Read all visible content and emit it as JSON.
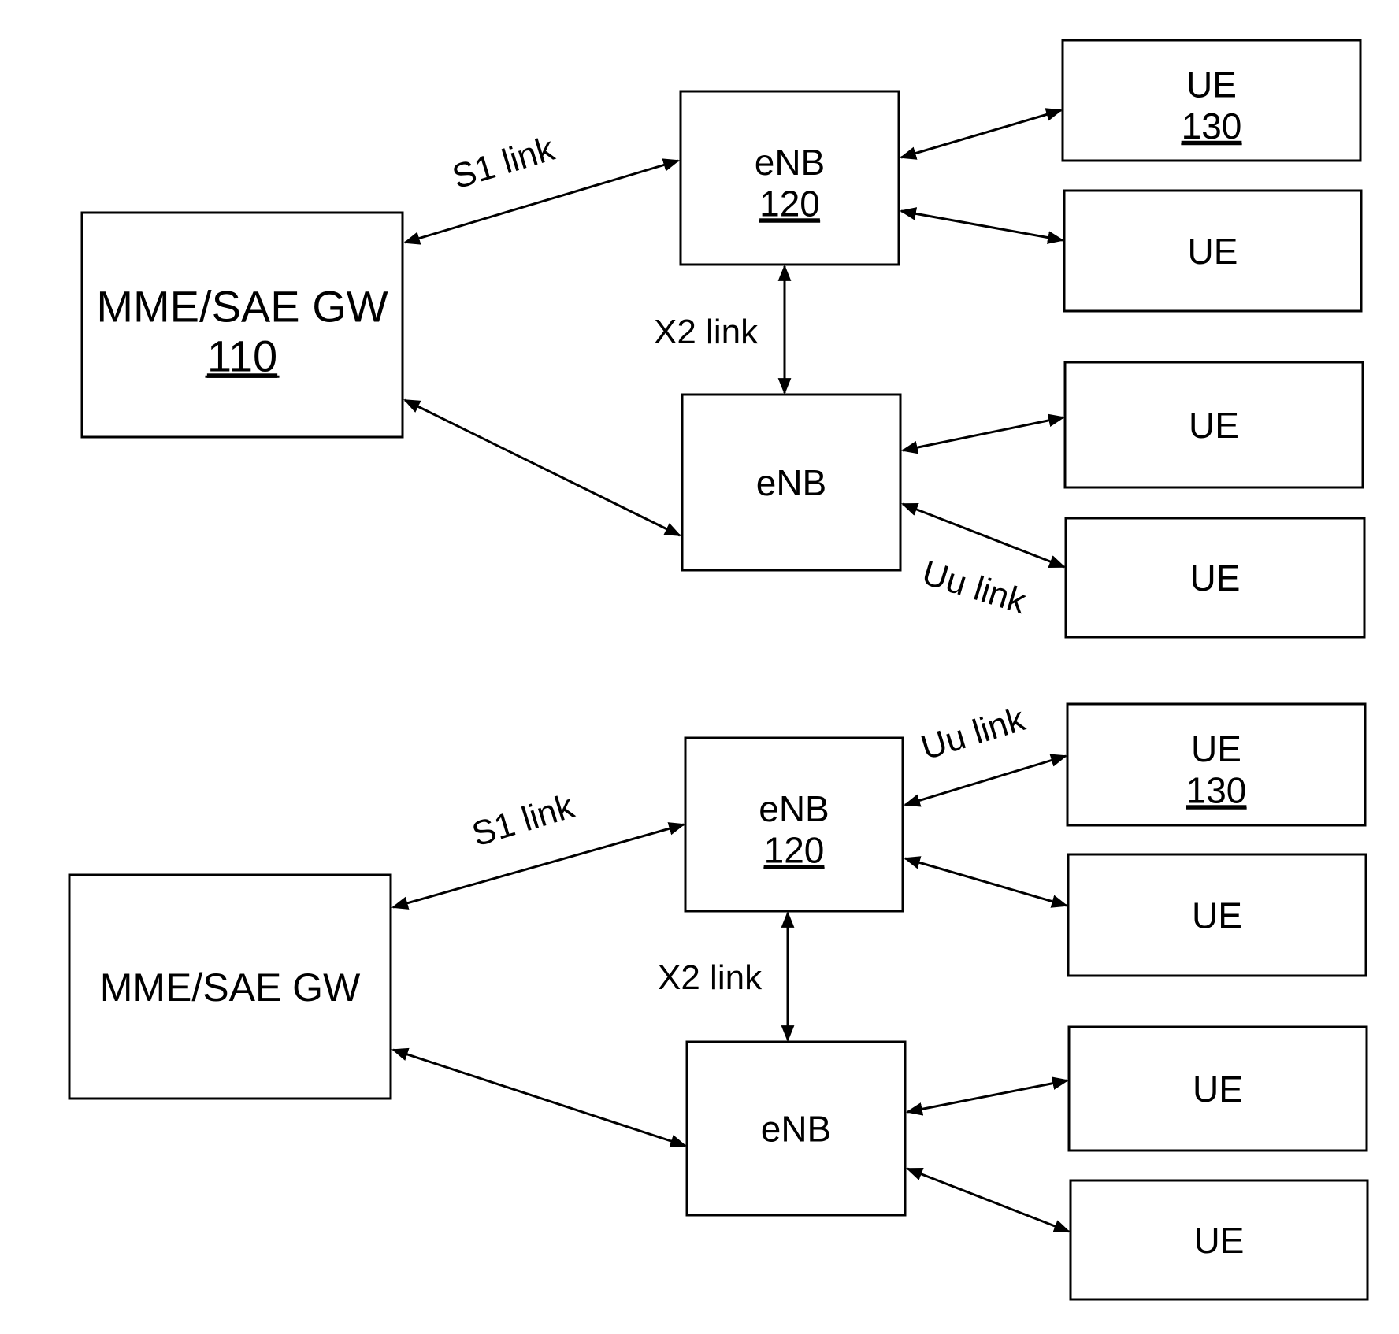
{
  "diagram": {
    "panels": [
      {
        "id": "top",
        "nodes": [
          {
            "id": "mme",
            "name": "MME/SAE GW",
            "ref": "110"
          },
          {
            "id": "enb1",
            "name": "eNB",
            "ref": "120"
          },
          {
            "id": "enb2",
            "name": "eNB",
            "ref": ""
          },
          {
            "id": "ue1",
            "name": "UE",
            "ref": "130"
          },
          {
            "id": "ue2",
            "name": "UE",
            "ref": ""
          },
          {
            "id": "ue3",
            "name": "UE",
            "ref": ""
          },
          {
            "id": "ue4",
            "name": "UE",
            "ref": ""
          }
        ],
        "links": [
          {
            "from": "mme",
            "to": "enb1",
            "label": "S1 link",
            "bidirectional": true
          },
          {
            "from": "mme",
            "to": "enb2",
            "label": "",
            "bidirectional": true
          },
          {
            "from": "enb1",
            "to": "enb2",
            "label": "X2 link",
            "bidirectional": true
          },
          {
            "from": "enb1",
            "to": "ue1",
            "label": "",
            "bidirectional": true
          },
          {
            "from": "enb1",
            "to": "ue2",
            "label": "",
            "bidirectional": true
          },
          {
            "from": "enb2",
            "to": "ue3",
            "label": "",
            "bidirectional": true
          },
          {
            "from": "enb2",
            "to": "ue4",
            "label": "Uu link",
            "bidirectional": true
          }
        ]
      },
      {
        "id": "bottom",
        "nodes": [
          {
            "id": "mme",
            "name": "MME/SAE GW",
            "ref": ""
          },
          {
            "id": "enb1",
            "name": "eNB",
            "ref": "120"
          },
          {
            "id": "enb2",
            "name": "eNB",
            "ref": ""
          },
          {
            "id": "ue1",
            "name": "UE",
            "ref": "130"
          },
          {
            "id": "ue2",
            "name": "UE",
            "ref": ""
          },
          {
            "id": "ue3",
            "name": "UE",
            "ref": ""
          },
          {
            "id": "ue4",
            "name": "UE",
            "ref": ""
          }
        ],
        "links": [
          {
            "from": "mme",
            "to": "enb1",
            "label": "S1 link",
            "bidirectional": true
          },
          {
            "from": "mme",
            "to": "enb2",
            "label": "",
            "bidirectional": true
          },
          {
            "from": "enb1",
            "to": "enb2",
            "label": "X2 link",
            "bidirectional": true
          },
          {
            "from": "enb1",
            "to": "ue1",
            "label": "Uu link",
            "bidirectional": true
          },
          {
            "from": "enb1",
            "to": "ue2",
            "label": "",
            "bidirectional": true
          },
          {
            "from": "enb2",
            "to": "ue3",
            "label": "",
            "bidirectional": true
          },
          {
            "from": "enb2",
            "to": "ue4",
            "label": "",
            "bidirectional": true
          }
        ]
      }
    ]
  }
}
